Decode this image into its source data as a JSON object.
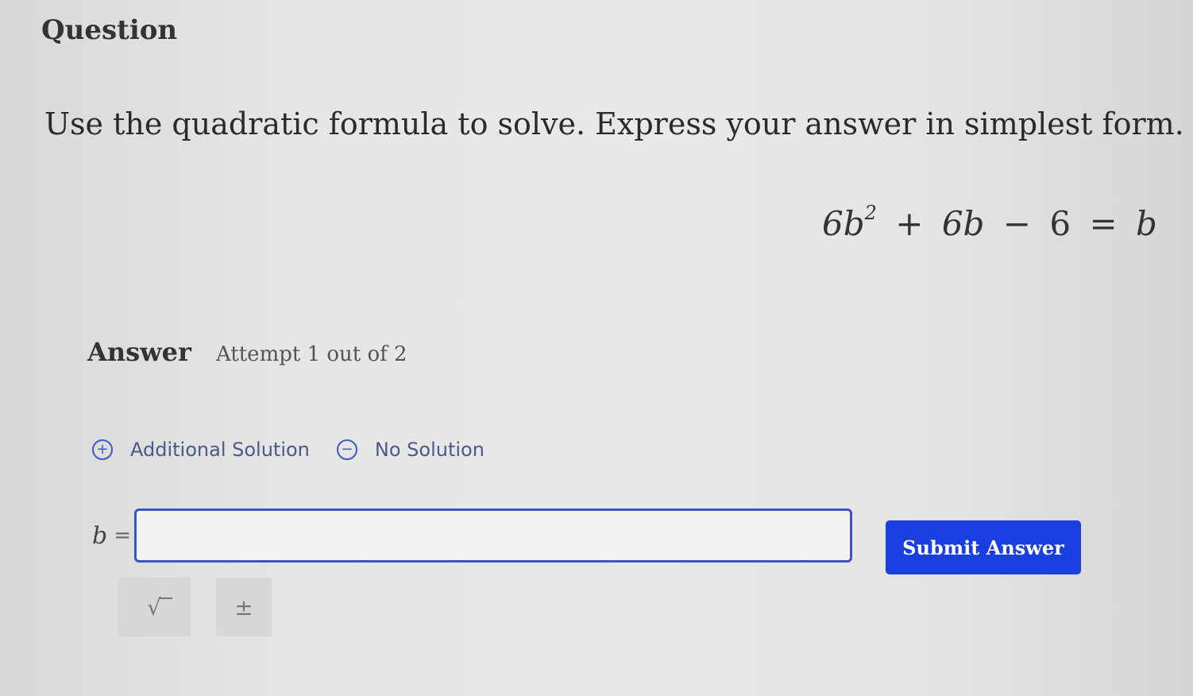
{
  "question": {
    "heading": "Question",
    "prompt": "Use the quadratic formula to solve. Express your answer in simplest form.",
    "equation": {
      "coef_a": "6b",
      "exponent": "2",
      "plus": "+",
      "term_b": "6b",
      "minus": "−",
      "constant": "6",
      "equals": "=",
      "rhs": "b"
    }
  },
  "answer": {
    "label": "Answer",
    "attempt": "Attempt 1 out of 2",
    "additional_solution_label": "Additional Solution",
    "no_solution_label": "No Solution",
    "variable": "b",
    "equals": "=",
    "input_value": "",
    "submit_label": "Submit Answer",
    "sqrt_symbol": "√",
    "plus_minus_symbol": "±"
  },
  "colors": {
    "accent": "#1a3fe0",
    "input_border": "#3b55c8",
    "link_text": "#4a5a8a"
  }
}
